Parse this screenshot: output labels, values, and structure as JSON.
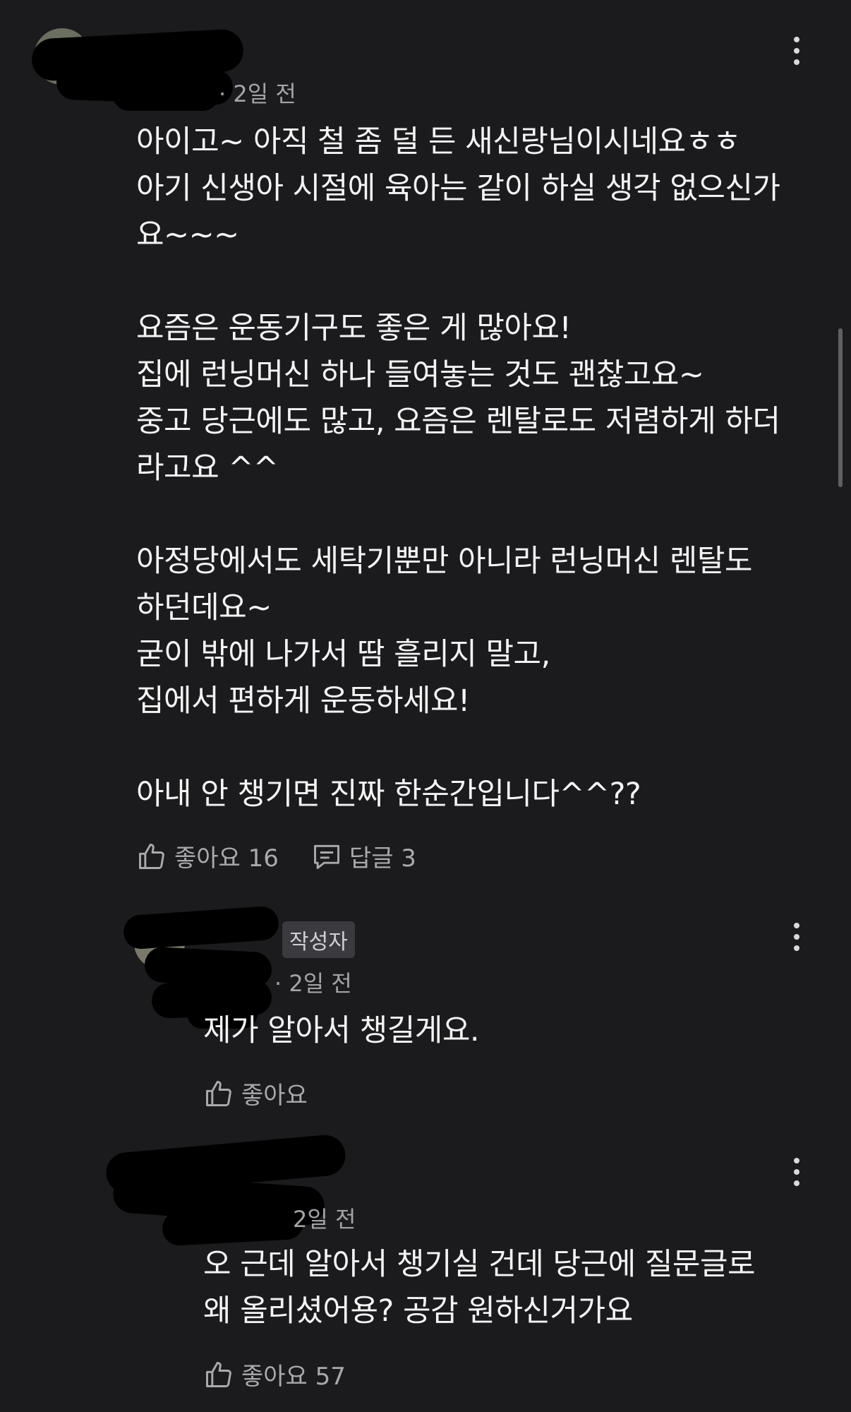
{
  "comments": [
    {
      "meta": "2일 전",
      "text": "아이고~ 아직 철 좀 덜 든 새신랑님이시네요ㅎㅎ\n아기 신생아 시절에 육아는 같이 하실 생각 없으신가\n요~~~\n\n요즘은 운동기구도 좋은 게 많아요!\n집에 런닝머신 하나 들여놓는 것도 괜찮고요~\n중고 당근에도 많고, 요즘은 렌탈로도 저렴하게 하더\n라고요 ^^\n\n아정당에서도 세탁기뿐만 아니라 런닝머신 렌탈도\n하던데요~\n굳이 밖에 나가서 땀 흘리지 말고,\n집에서 편하게 운동하세요!\n\n아내 안 챙기면 진짜 한순간입니다^^??",
      "like_label": "좋아요 16",
      "reply_label": "답글 3"
    },
    {
      "badge": "작성자",
      "meta": "2일 전",
      "text": "제가 알아서 챙길게요.",
      "like_label": "좋아요"
    },
    {
      "meta": "2일 전",
      "text": "오 근데 알아서 챙기실 건데 당근에 질문글로\n왜 올리셨어용? 공감 원하신거가요",
      "like_label": "좋아요 57"
    }
  ],
  "icons": {
    "like": "thumbs-up-icon",
    "reply": "reply-icon",
    "more": "more-vertical-icon"
  },
  "colors": {
    "background": "#1b1b1e",
    "text": "#f4f4f4",
    "muted": "#a3a3a8",
    "badge_bg": "#3a3a3f"
  }
}
